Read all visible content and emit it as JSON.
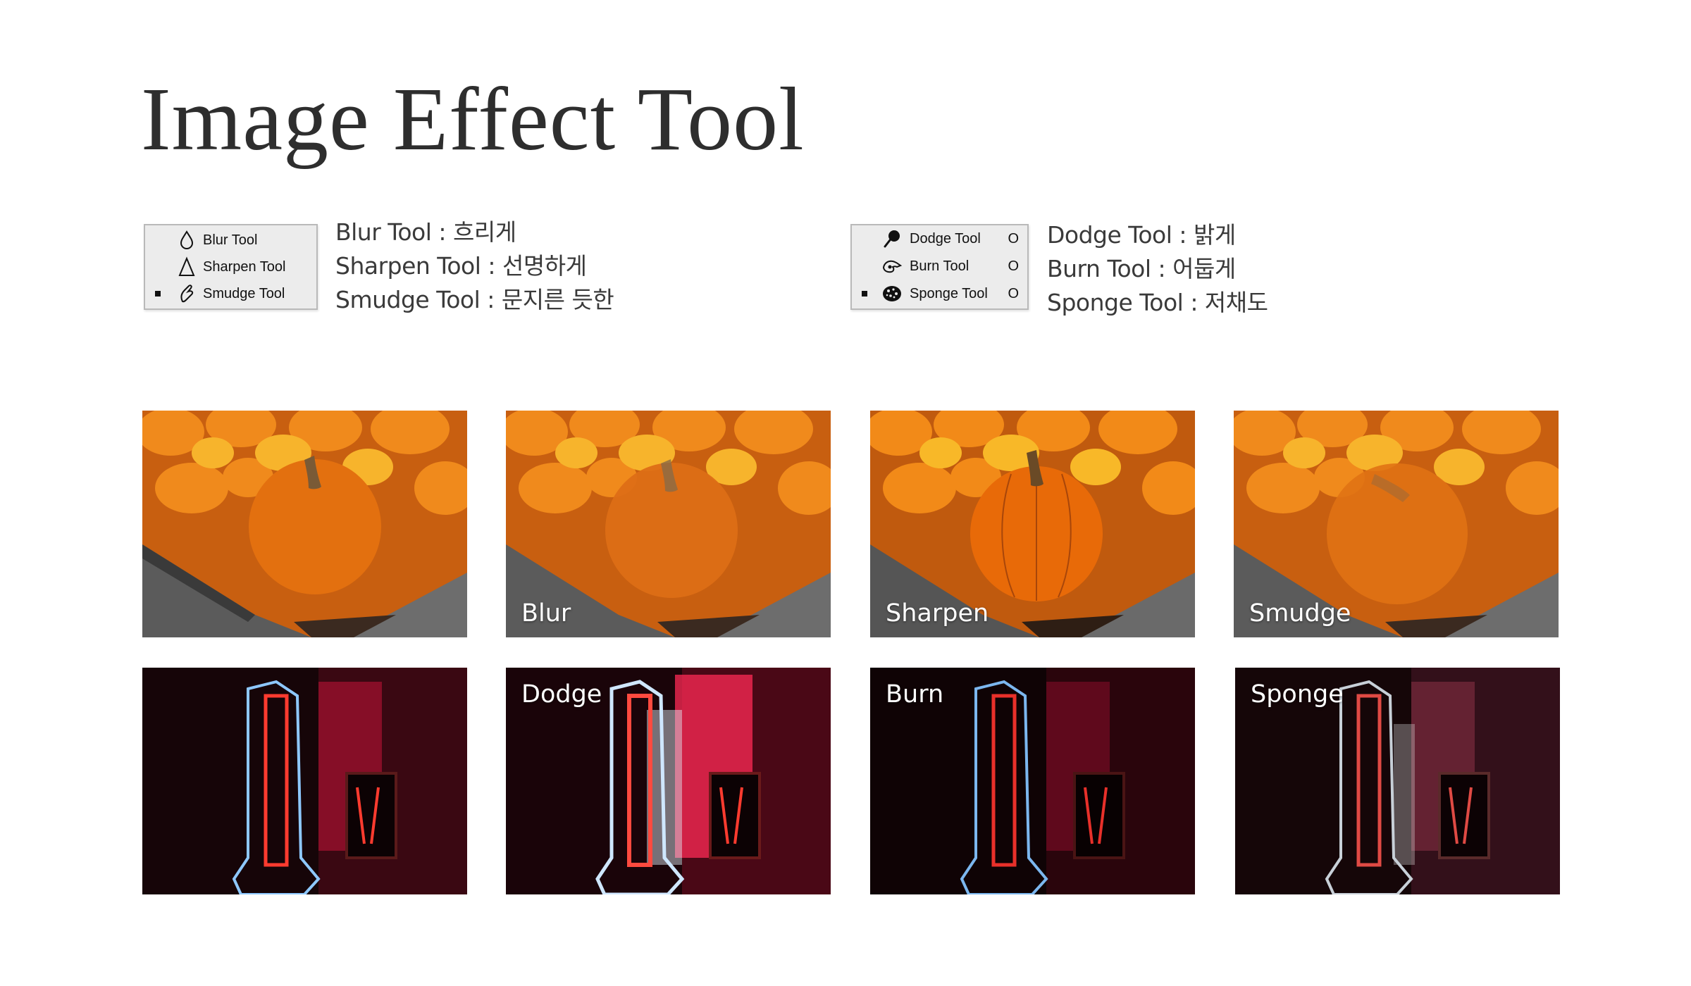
{
  "title": "Image Effect Tool",
  "panels": [
    {
      "tools": [
        {
          "label": "Blur Tool",
          "icon": "drop-icon"
        },
        {
          "label": "Sharpen Tool",
          "icon": "triangle-icon"
        },
        {
          "label": "Smudge Tool",
          "icon": "finger-icon"
        }
      ],
      "descriptions": [
        "Blur Tool : 흐리게",
        "Sharpen Tool : 선명하게",
        "Smudge Tool : 문지른 듯한"
      ]
    },
    {
      "tools": [
        {
          "label": "Dodge Tool",
          "icon": "dodge-icon",
          "shortcut": "O"
        },
        {
          "label": "Burn Tool",
          "icon": "burn-hand-icon",
          "shortcut": "O"
        },
        {
          "label": "Sponge Tool",
          "icon": "sponge-icon",
          "shortcut": "O"
        }
      ],
      "descriptions": [
        "Dodge Tool : 밝게",
        "Burn Tool : 어둡게",
        "Sponge Tool : 저채도"
      ]
    }
  ],
  "pumpkin_row": [
    "",
    "Blur",
    "Sharpen",
    "Smudge"
  ],
  "neon_row": [
    "",
    "Dodge",
    "Burn",
    "Sponge"
  ],
  "colors": {
    "pumpkin": "#e3700f",
    "wood": "#4e4e4e",
    "neon_red": "#ff3b2f",
    "neon_blue": "#8ec8ff",
    "dark_bg": "#160508"
  }
}
